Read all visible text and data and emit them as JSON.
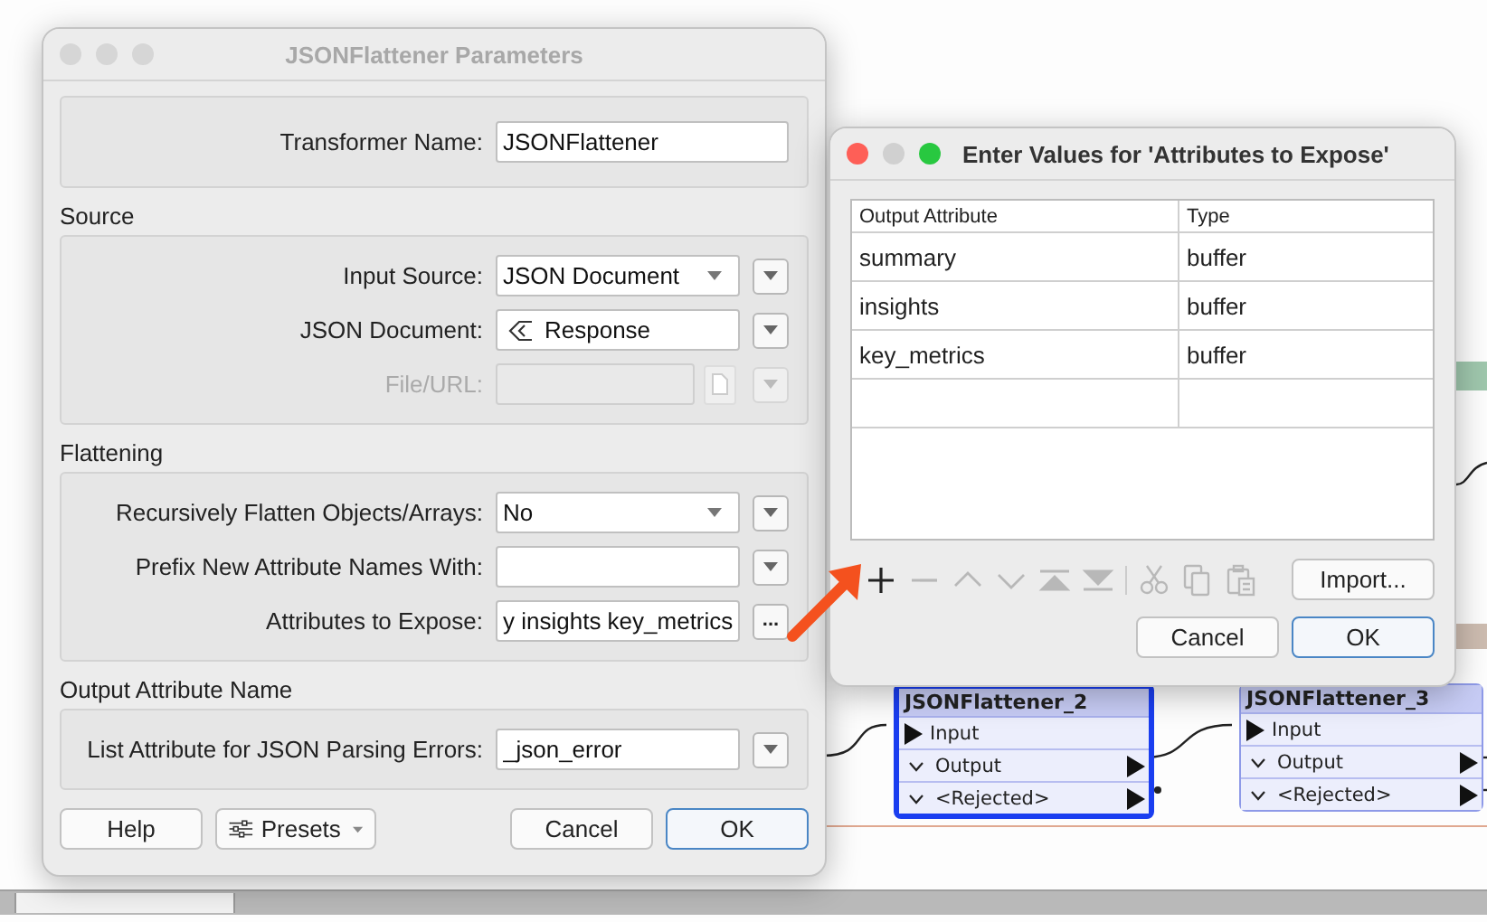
{
  "canvas": {
    "nodes": [
      {
        "title": "JSONFlattener_2",
        "selected": true,
        "ports": [
          {
            "kind": "input",
            "label": "Input"
          },
          {
            "kind": "output",
            "label": "Output"
          },
          {
            "kind": "output",
            "label": "<Rejected>"
          }
        ]
      },
      {
        "title": "JSONFlattener_3",
        "selected": false,
        "ports": [
          {
            "kind": "input",
            "label": "Input"
          },
          {
            "kind": "output",
            "label": "Output"
          },
          {
            "kind": "output",
            "label": "<Rejected>"
          }
        ]
      }
    ]
  },
  "main_dialog": {
    "title": "JSONFlattener Parameters",
    "active": false,
    "transformer_name": {
      "label": "Transformer Name:",
      "value": "JSONFlattener"
    },
    "sections": [
      {
        "title": "Source",
        "fields": [
          {
            "kind": "select",
            "label": "Input Source:",
            "value": "JSON Document",
            "disabled": false
          },
          {
            "kind": "attribute",
            "label": "JSON Document:",
            "value": "Response",
            "disabled": false
          },
          {
            "kind": "file",
            "label": "File/URL:",
            "disabled": true
          }
        ]
      },
      {
        "title": "Flattening",
        "fields": [
          {
            "kind": "select",
            "label": "Recursively Flatten Objects/Arrays:",
            "value": "No",
            "disabled": false
          },
          {
            "kind": "text",
            "label": "Prefix New Attribute Names With:",
            "disabled": false
          },
          {
            "kind": "expose",
            "label": "Attributes to Expose:",
            "value": "y insights key_metrics",
            "button": "...",
            "disabled": false
          }
        ]
      },
      {
        "title": "Output Attribute Name",
        "fields": [
          {
            "kind": "text",
            "label": "List Attribute for JSON Parsing Errors:",
            "value": "_json_error",
            "disabled": false
          }
        ]
      }
    ],
    "buttons": [
      {
        "kind": "help",
        "label": "Help"
      },
      {
        "kind": "presets",
        "label": "Presets"
      },
      {
        "kind": "cancel",
        "label": "Cancel"
      },
      {
        "kind": "ok",
        "label": "OK"
      }
    ]
  },
  "values_dialog": {
    "title": "Enter Values for 'Attributes to Expose'",
    "active": true,
    "columns": [
      "Output Attribute",
      "Type"
    ],
    "rows": [
      {
        "cells": [
          "summary",
          "buffer"
        ]
      },
      {
        "cells": [
          "insights",
          "buffer"
        ]
      },
      {
        "cells": [
          "key_metrics",
          "buffer"
        ]
      }
    ],
    "toolbar": [
      {
        "kind": "add",
        "disabled": false
      },
      {
        "kind": "remove",
        "disabled": true
      },
      {
        "kind": "up",
        "disabled": true
      },
      {
        "kind": "down",
        "disabled": true
      },
      {
        "kind": "top",
        "disabled": true
      },
      {
        "kind": "bottom",
        "disabled": true
      },
      {
        "kind": "cut",
        "disabled": true
      },
      {
        "kind": "copy",
        "disabled": true
      },
      {
        "kind": "paste",
        "disabled": true
      }
    ],
    "import_button": "Import...",
    "buttons": [
      {
        "kind": "cancel",
        "label": "Cancel"
      },
      {
        "kind": "ok",
        "label": "OK"
      }
    ]
  }
}
